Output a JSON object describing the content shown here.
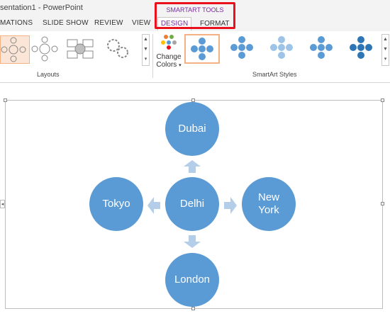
{
  "window": {
    "title": "sentation1 - PowerPoint"
  },
  "ribbon_tabs": [
    "MATIONS",
    "SLIDE SHOW",
    "REVIEW",
    "VIEW"
  ],
  "contextual": {
    "group_title": "SMARTART TOOLS",
    "design_tab": "DESIGN",
    "format_tab": "FORMAT",
    "highlight_color": "#e8111c",
    "label_color": "#7a2a9c"
  },
  "layouts": {
    "group_label": "Layouts",
    "selected_index": 0
  },
  "change_colors": {
    "line1": "Change",
    "line2": "Colors",
    "arrow": "▾"
  },
  "smartart_styles": {
    "group_label": "SmartArt Styles",
    "selected_index": 0
  },
  "scroll": {
    "up": "▲",
    "down": "▼",
    "more": "▾"
  },
  "side_tab_glyph": "◂",
  "diagram": {
    "accent_color": "#5b9bd5",
    "arrow_color": "#b4cde9",
    "center": "Delhi",
    "top": "Dubai",
    "left": "Tokyo",
    "right_line1": "New",
    "right_line2": "York",
    "bottom": "London"
  }
}
